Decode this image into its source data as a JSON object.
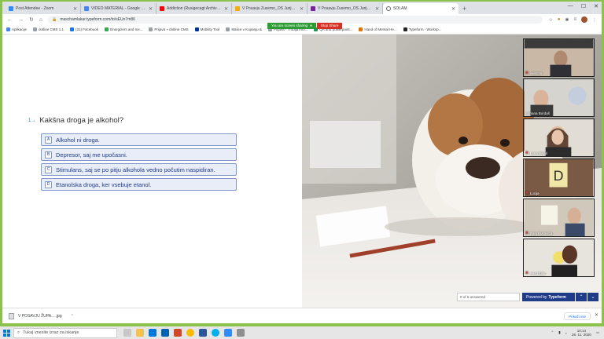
{
  "tabs": [
    {
      "label": "Post Attendee - Zoom",
      "color": "#2d8cff",
      "active": false
    },
    {
      "label": "VIDEO MATERIAL - Google Driv",
      "color": "#4285f4",
      "active": false
    },
    {
      "label": "Addiction (Rusigecagt Archives)",
      "color": "#ff0000",
      "active": false
    },
    {
      "label": "V Posavju Zusemo_OŠ Jurija Dal",
      "color": "#f9ab00",
      "active": false
    },
    {
      "label": "V Posavju Zusemo_OŠ Jurija Dal",
      "color": "#7b1fa2",
      "active": false
    },
    {
      "label": "SOLAM",
      "color": "#5f6368",
      "active": true
    }
  ],
  "screen_share": {
    "status": "You are screen sharing",
    "stop": "Stop Share"
  },
  "address": {
    "url": "maschamlakar.typeform.com/to/sEUn7m86"
  },
  "bookmarks": [
    "Aplikacije",
    "dotline CMS 1.1",
    "(31) Facebook",
    "Energizers and Ice...",
    "Prijava » dotline CMS",
    "Mobility Tool",
    "Malice v Kopanju &",
    "Prijava - Trobija.info...",
    "QA and powerpoint...",
    "Hand of Mental He...",
    "Typeform - Worksp..."
  ],
  "question": {
    "number": "1→",
    "text": "Kakšna droga je alkohol?",
    "choices": [
      {
        "key": "A",
        "label": "Alkohol ni droga."
      },
      {
        "key": "B",
        "label": "Depresor, saj me upočasni."
      },
      {
        "key": "C",
        "label": "Stimulans, saj se po pitju alkohola vedno počutim naspidiran."
      },
      {
        "key": "D",
        "label": "Etanolska droga, ker vsebuje etanol."
      }
    ]
  },
  "progress": {
    "answered": "0 of 6 answered",
    "powered_prefix": "Powered by",
    "brand": "Typeform"
  },
  "participants": [
    {
      "name": "valentin",
      "bg": "#c9b8a6"
    },
    {
      "name": "Adriana Bordaš",
      "bg": "#d6d4cf"
    },
    {
      "name": "Lana Balaš",
      "bg": "#e2ddd4"
    },
    {
      "name": "Lucija",
      "bg": "#7a5a44"
    },
    {
      "name": "Anej Kukovica",
      "bg": "#cfc8bb"
    },
    {
      "name": "Ana Dular",
      "bg": "#e7e3dd"
    }
  ],
  "downloads": {
    "file": "V POSAVJU ŽUPA.....jpg",
    "show_all": "Prikaži vse"
  },
  "taskbar": {
    "search_placeholder": "Tukaj vnesite izraz za iskanje",
    "time": "10:14",
    "date": "26. 11. 2020"
  }
}
